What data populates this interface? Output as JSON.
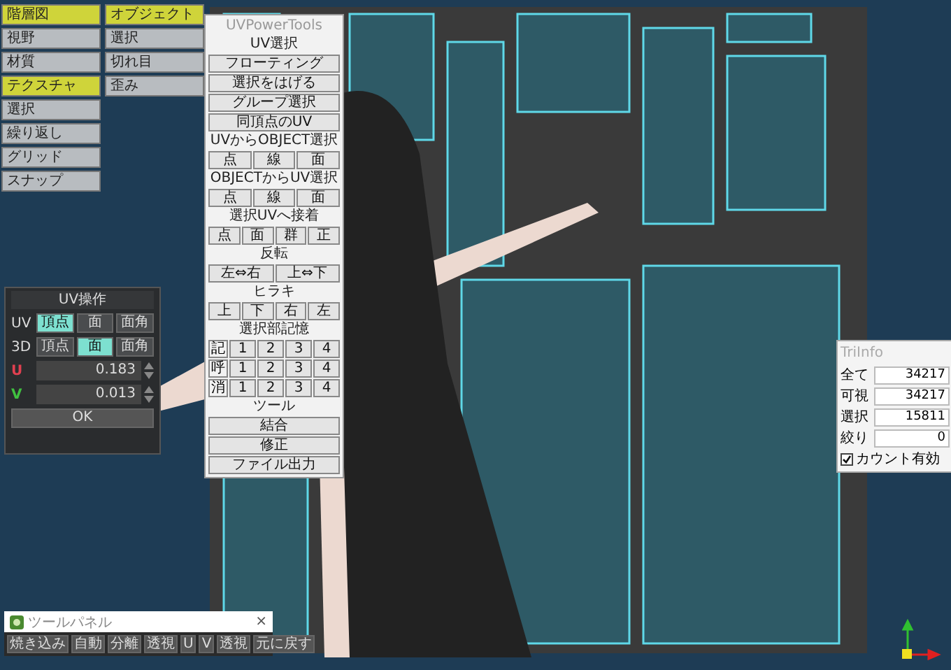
{
  "command_panel": {
    "column_1": [
      {
        "label": "階層図",
        "selected": true
      },
      {
        "label": "視野",
        "selected": false
      },
      {
        "label": "材質",
        "selected": false
      },
      {
        "label": "テクスチャ",
        "selected": true
      },
      {
        "label": "選択",
        "selected": false
      },
      {
        "label": "繰り返し",
        "selected": false
      },
      {
        "label": "グリッド",
        "selected": false
      },
      {
        "label": "スナップ",
        "selected": false
      }
    ],
    "column_2": [
      {
        "label": "オブジェクト",
        "selected": true
      },
      {
        "label": "選択",
        "selected": false
      },
      {
        "label": "切れ目",
        "selected": false
      },
      {
        "label": "歪み",
        "selected": false
      }
    ]
  },
  "uv_power_tools": {
    "title": "UVPowerTools",
    "items": [
      {
        "kind": "heading",
        "text": "UV選択"
      },
      {
        "kind": "button",
        "text": "フローティング"
      },
      {
        "kind": "button",
        "text": "選択をはげる"
      },
      {
        "kind": "button",
        "text": "グループ選択"
      },
      {
        "kind": "button",
        "text": "同頂点のUV"
      },
      {
        "kind": "heading",
        "text": "UVからOBJECT選択"
      },
      {
        "kind": "row",
        "buttons": [
          "点",
          "線",
          "面"
        ]
      },
      {
        "kind": "heading",
        "text": "OBJECTからUV選択"
      },
      {
        "kind": "row",
        "buttons": [
          "点",
          "線",
          "面"
        ]
      },
      {
        "kind": "heading",
        "text": "選択UVへ接着"
      },
      {
        "kind": "row",
        "buttons": [
          "点",
          "面",
          "群",
          "正"
        ]
      },
      {
        "kind": "heading",
        "text": "反転"
      },
      {
        "kind": "row",
        "buttons": [
          "左⇔右",
          "上⇔下"
        ]
      },
      {
        "kind": "heading",
        "text": "ヒラキ"
      },
      {
        "kind": "row",
        "buttons": [
          "上",
          "下",
          "右",
          "左"
        ]
      },
      {
        "kind": "heading",
        "text": "選択部記憶"
      },
      {
        "kind": "memory",
        "label": "記",
        "buttons": [
          "1",
          "2",
          "3",
          "4"
        ]
      },
      {
        "kind": "memory",
        "label": "呼",
        "buttons": [
          "1",
          "2",
          "3",
          "4"
        ]
      },
      {
        "kind": "memory",
        "label": "消",
        "buttons": [
          "1",
          "2",
          "3",
          "4"
        ]
      },
      {
        "kind": "heading",
        "text": "ツール"
      },
      {
        "kind": "button",
        "text": "結合"
      },
      {
        "kind": "button",
        "text": "修正"
      },
      {
        "kind": "button",
        "text": "ファイル出力"
      }
    ]
  },
  "uv_operation": {
    "title": "UV操作",
    "modes": [
      {
        "label": "UV",
        "options": [
          {
            "label": "頂点",
            "selected": true
          },
          {
            "label": "面",
            "selected": false
          },
          {
            "label": "面角",
            "selected": false
          }
        ]
      },
      {
        "label": "3D",
        "options": [
          {
            "label": "頂点",
            "selected": false
          },
          {
            "label": "面",
            "selected": true
          },
          {
            "label": "面角",
            "selected": false
          }
        ]
      }
    ],
    "fields": [
      {
        "label": "U",
        "value": "0.183",
        "color": "#e04050"
      },
      {
        "label": "V",
        "value": "0.013",
        "color": "#40c040"
      }
    ],
    "ok_button": "OK"
  },
  "tally": {
    "title": "TriInfo",
    "rows": [
      {
        "label": "全て",
        "value": "34217"
      },
      {
        "label": "可視",
        "value": "34217"
      },
      {
        "label": "選択",
        "value": "15811"
      },
      {
        "label": "絞り",
        "value": "0"
      }
    ],
    "count_enabled": {
      "label": "カウント有効",
      "checked": true
    }
  },
  "tool_panel": {
    "title": "ツールパネル",
    "close": "×",
    "buttons": [
      "焼き込み",
      "自動",
      "分離",
      "透視",
      "U",
      "V",
      "透視",
      "元に戻す"
    ]
  }
}
